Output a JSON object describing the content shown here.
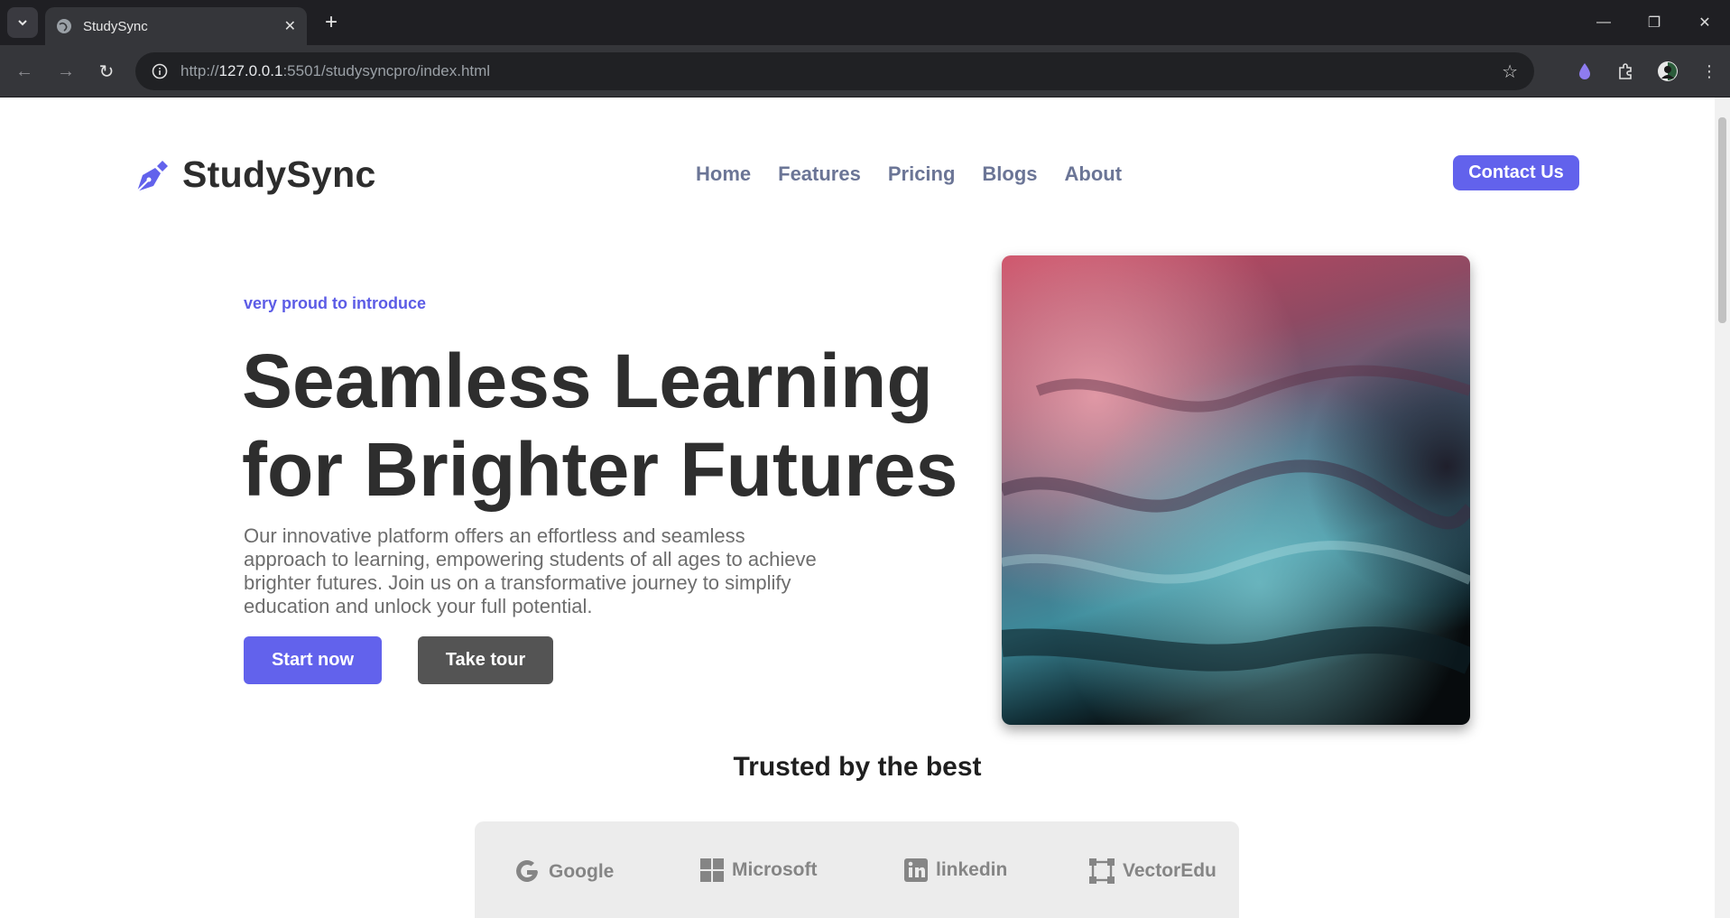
{
  "browser": {
    "tab_title": "StudySync",
    "url_scheme": "http://",
    "url_host": "127.0.0.1",
    "url_rest": ":5501/studysyncpro/index.html",
    "icons": [
      "chevron-down-icon",
      "globe-icon",
      "close-icon",
      "plus-icon",
      "minimize-icon",
      "restore-icon",
      "close-window-icon",
      "back-icon",
      "forward-icon",
      "reload-icon",
      "info-icon",
      "star-icon",
      "extension-icon",
      "puzzle-icon",
      "avatar",
      "menu-icon"
    ]
  },
  "header": {
    "brand": "StudySync",
    "nav": [
      "Home",
      "Features",
      "Pricing",
      "Blogs",
      "About"
    ],
    "contact_label": "Contact Us"
  },
  "hero": {
    "eyebrow": "very proud to introduce",
    "headline_line1": "Seamless Learning",
    "headline_line2": "for Brighter Futures",
    "lead": "Our innovative platform offers an effortless and seamless approach to learning, empowering students of all ages to achieve brighter futures. Join us on a transformative journey to simplify education and unlock your full potential.",
    "primary_cta": "Start now",
    "secondary_cta": "Take tour"
  },
  "trusted": {
    "title": "Trusted by the best",
    "logos": [
      "Google",
      "Microsoft",
      "linkedin",
      "VectorEdu"
    ]
  },
  "colors": {
    "accent": "#6262ec",
    "dark_button": "#545454",
    "nav_text": "#6b7596",
    "heading": "#2e2e2e"
  }
}
